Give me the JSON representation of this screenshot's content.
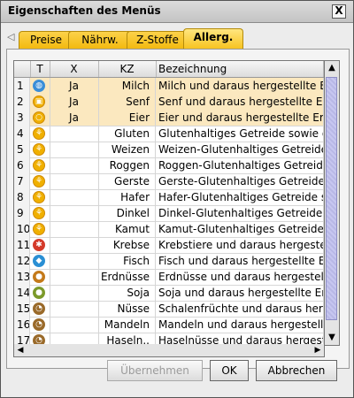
{
  "window": {
    "title": "Eigenschaften des Menüs",
    "close_label": "X"
  },
  "tabs": [
    {
      "label": "Preise"
    },
    {
      "label": "Nährw."
    },
    {
      "label": "Z-Stoffe"
    },
    {
      "label": "Allerg."
    }
  ],
  "table": {
    "columns": [
      "T",
      "X",
      "KZ",
      "Bezeichnung"
    ],
    "rows": [
      {
        "n": "1",
        "x": "Ja",
        "kz": "Milch",
        "desc": "Milch und daraus hergestellte Erz..",
        "icon": "milk-icon"
      },
      {
        "n": "2",
        "x": "Ja",
        "kz": "Senf",
        "desc": "Senf und daraus hergestellte Erz..",
        "icon": "mustard-icon"
      },
      {
        "n": "3",
        "x": "Ja",
        "kz": "Eier",
        "desc": "Eier und daraus hergestellte Erz..",
        "icon": "egg-icon"
      },
      {
        "n": "4",
        "x": "",
        "kz": "Gluten",
        "desc": "Glutenhaltiges Getreide sowie d..",
        "icon": "gluten-icon"
      },
      {
        "n": "5",
        "x": "",
        "kz": "Weizen",
        "desc": "Weizen-Glutenhaltiges Getreide o..",
        "icon": "wheat-icon"
      },
      {
        "n": "6",
        "x": "",
        "kz": "Roggen",
        "desc": "Roggen-Glutenhaltiges Getreide..",
        "icon": "rye-icon"
      },
      {
        "n": "7",
        "x": "",
        "kz": "Gerste",
        "desc": "Gerste-Glutenhaltiges Getreide o..",
        "icon": "barley-icon"
      },
      {
        "n": "8",
        "x": "",
        "kz": "Hafer",
        "desc": "Hafer-Glutenhaltiges Getreide s..",
        "icon": "oat-icon"
      },
      {
        "n": "9",
        "x": "",
        "kz": "Dinkel",
        "desc": "Dinkel-Glutenhaltiges Getreide o..",
        "icon": "spelt-icon"
      },
      {
        "n": "10",
        "x": "",
        "kz": "Kamut",
        "desc": "Kamut-Glutenhaltiges Getreide o..",
        "icon": "kamut-icon"
      },
      {
        "n": "11",
        "x": "",
        "kz": "Krebse",
        "desc": "Krebstiere und daraus hergestell..",
        "icon": "crab-icon"
      },
      {
        "n": "12",
        "x": "",
        "kz": "Fisch",
        "desc": "Fisch und daraus hergestellte Erz..",
        "icon": "fish-icon"
      },
      {
        "n": "13",
        "x": "",
        "kz": "Erdnüsse",
        "desc": "Erdnüsse und daraus hergestellt..",
        "icon": "peanut-icon"
      },
      {
        "n": "14",
        "x": "",
        "kz": "Soja",
        "desc": "Soja und daraus hergestellte Erz..",
        "icon": "soy-icon"
      },
      {
        "n": "15",
        "x": "",
        "kz": "Nüsse",
        "desc": "Schalenfrüchte und daraus herg..",
        "icon": "nut-icon"
      },
      {
        "n": "16",
        "x": "",
        "kz": "Mandeln",
        "desc": "Mandeln und daraus hergestellte..",
        "icon": "almond-icon"
      },
      {
        "n": "17",
        "x": "",
        "kz": "Haseln..",
        "desc": "Haselnüsse und daraus hergeste..",
        "icon": "hazelnut-icon"
      }
    ]
  },
  "buttons": {
    "apply_label": "Übernehmen",
    "ok_label": "OK",
    "cancel_label": "Abbrechen"
  },
  "colors": {
    "tab_yellow": "#f2b80c",
    "highlight_row": "#fbe8bf",
    "scroll_thumb": "#b8b8e6"
  }
}
